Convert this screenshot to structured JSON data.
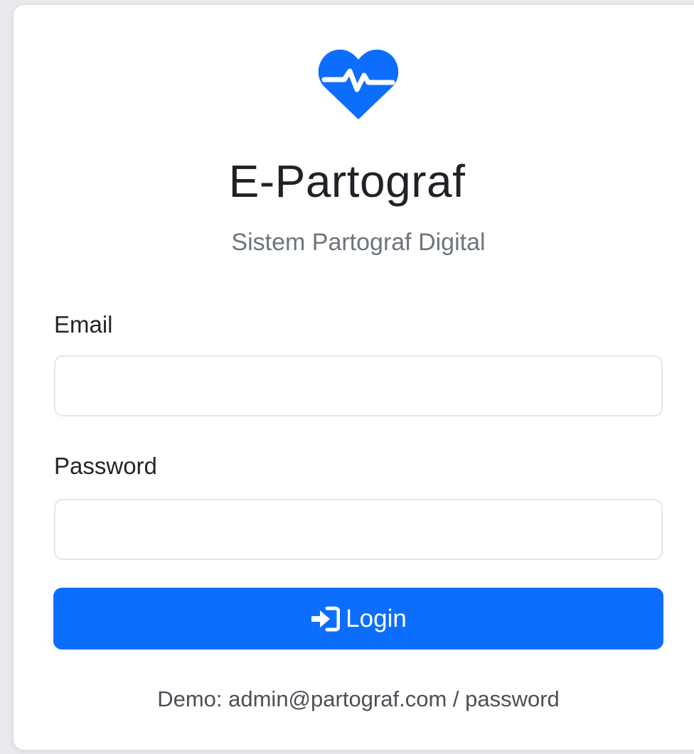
{
  "app": {
    "title": "E-Partograf",
    "subtitle": "Sistem Partograf Digital",
    "logo_icon": "heart-pulse-icon",
    "accent_color": "#0d6efd"
  },
  "form": {
    "email_label": "Email",
    "email_value": "",
    "password_label": "Password",
    "password_value": "",
    "login_label": "Login",
    "login_icon": "sign-in-icon"
  },
  "footer": {
    "demo_text": "Demo: admin@partograf.com / password"
  }
}
